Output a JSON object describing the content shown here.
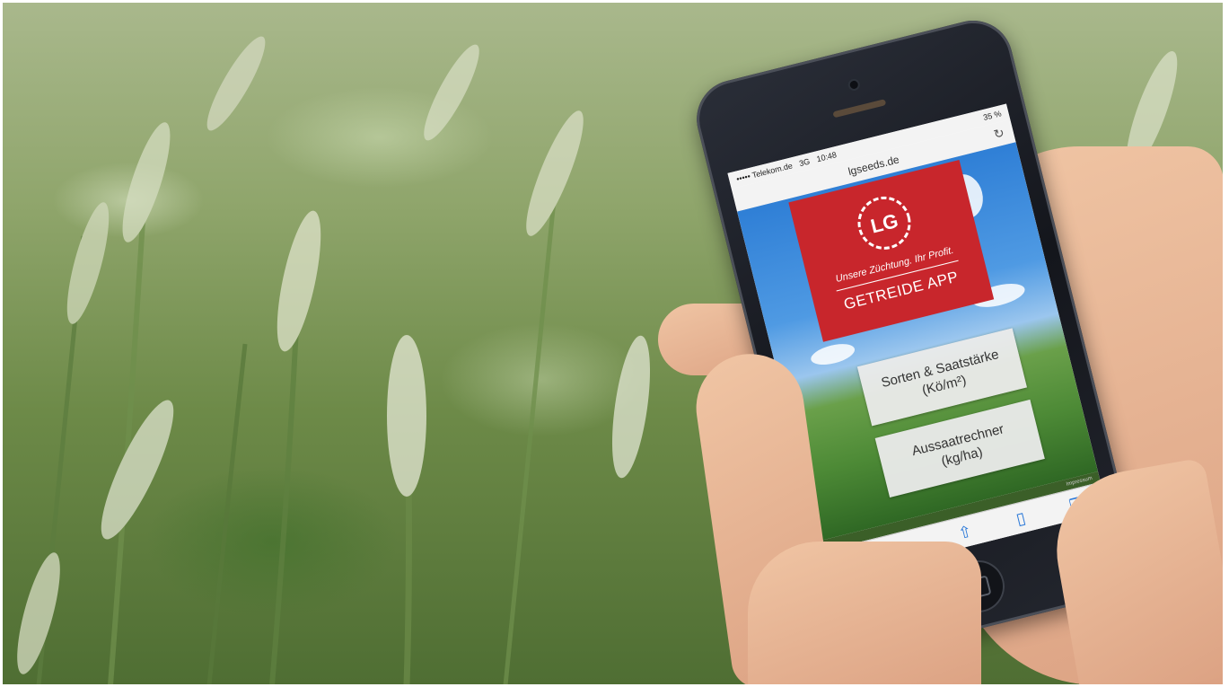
{
  "status_bar": {
    "carrier": "••••• Telekom.de",
    "network": "3G",
    "time": "10:48",
    "battery": "35 %"
  },
  "browser": {
    "url": "lgseeds.de"
  },
  "app": {
    "logo_text": "LG",
    "slogan": "Unsere Züchtung. Ihr Profit.",
    "title": "GETREIDE APP",
    "buttons": [
      {
        "line1": "Sorten & Saatstärke",
        "line2": "(Kö/m²)"
      },
      {
        "line1": "Aussaatrechner",
        "line2": "(kg/ha)"
      }
    ],
    "footer_text": "Impressum"
  },
  "toolbar": {
    "back_icon": "chevron-left-icon",
    "forward_icon": "chevron-right-icon",
    "share_icon": "share-icon",
    "bookmarks_icon": "book-icon",
    "tabs_icon": "tabs-icon"
  },
  "colors": {
    "brand_red": "#c8262c",
    "ios_blue": "#2a78d8"
  }
}
